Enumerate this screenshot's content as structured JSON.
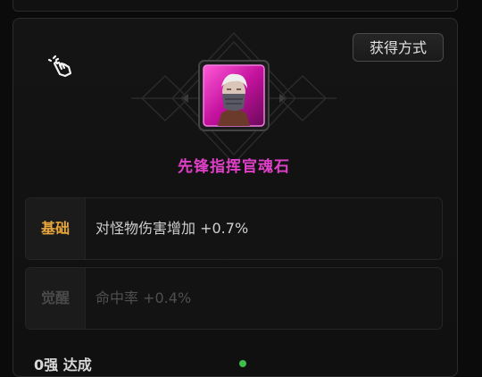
{
  "acquire_button": "获得方式",
  "item": {
    "name": "先锋指挥官魂石",
    "rarity_color": "#e040c8"
  },
  "stats": {
    "basic": {
      "label": "基础",
      "value": "对怪物伤害增加 +0.7%"
    },
    "awaken": {
      "label": "觉醒",
      "value": "命中率 +0.4%"
    }
  },
  "bottom": {
    "text": "0强 达成"
  },
  "icons": {
    "tap": "tap-hand-icon",
    "portrait": "masked-commander-portrait"
  }
}
